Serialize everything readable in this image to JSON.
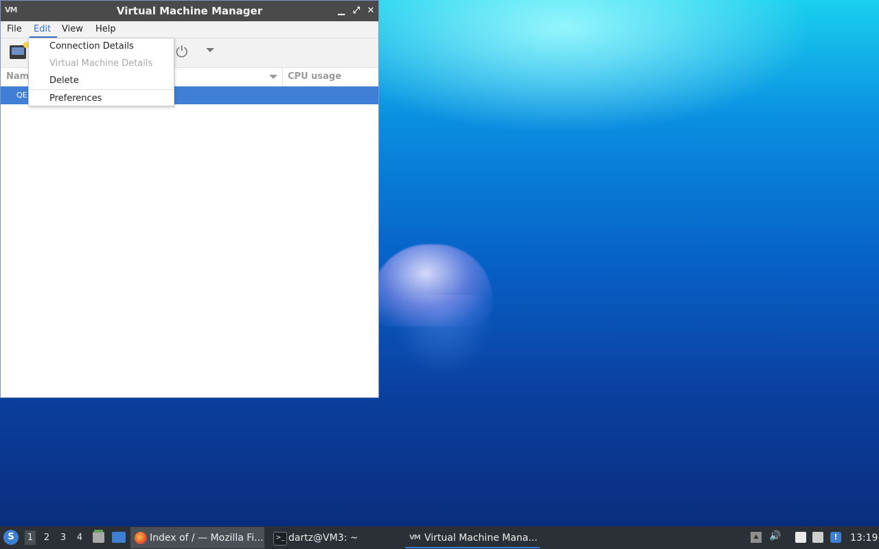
{
  "window": {
    "title": "Virtual Machine Manager",
    "controls": {
      "minimize": "▁",
      "maximize": "⤢",
      "close": "✕"
    }
  },
  "menubar": {
    "file": "File",
    "edit": "Edit",
    "view": "View",
    "help": "Help"
  },
  "edit_menu": {
    "items": [
      {
        "label": "Connection Details",
        "enabled": true
      },
      {
        "label": "Virtual Machine Details",
        "enabled": false
      },
      {
        "label": "Delete",
        "enabled": true
      },
      {
        "label": "Preferences",
        "enabled": true
      }
    ]
  },
  "list": {
    "columns": {
      "name": "Nam",
      "cpu": "CPU usage"
    },
    "rows": [
      {
        "name": "QE",
        "selected": true
      }
    ]
  },
  "taskbar": {
    "workspaces": [
      "1",
      "2",
      "3",
      "4"
    ],
    "current_workspace": "1",
    "tasks": [
      {
        "label": "Index of / — Mozilla Fi...",
        "icon": "firefox-icon"
      },
      {
        "label": "dartz@VM3: ~",
        "icon": "terminal-icon"
      },
      {
        "label": "Virtual Machine Mana...",
        "icon": "virt-manager-icon"
      }
    ],
    "clock": "13:19"
  },
  "colors": {
    "accent": "#3f7fd6",
    "taskbar": "#2b3036",
    "titlebar": "#4a4a4a"
  }
}
